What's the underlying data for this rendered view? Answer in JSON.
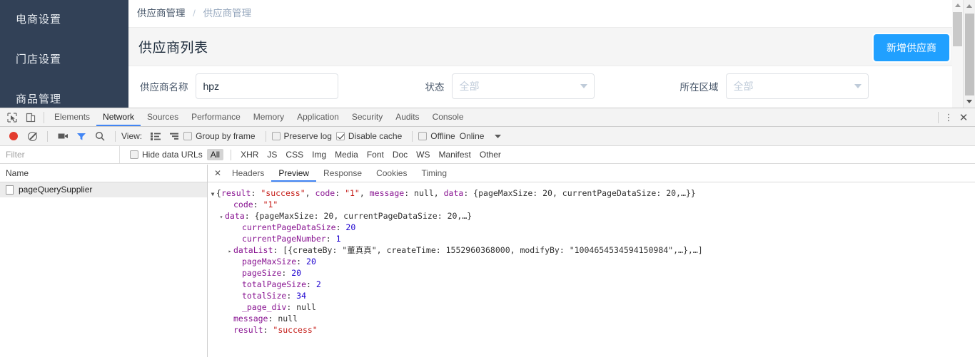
{
  "app": {
    "sidebar": {
      "items": [
        {
          "label": "电商设置",
          "name": "sidebar-item-ecommerce-settings"
        },
        {
          "label": "门店设置",
          "name": "sidebar-item-store-settings"
        },
        {
          "label": "商品管理",
          "name": "sidebar-item-product-management"
        }
      ]
    },
    "breadcrumb": {
      "current": "供应商管理",
      "separator": "/",
      "sub": "供应商管理"
    },
    "panel": {
      "title": "供应商列表",
      "add_button": "新增供应商"
    },
    "filters": [
      {
        "label": "供应商名称",
        "type": "text",
        "value": "hpz",
        "placeholder": ""
      },
      {
        "label": "状态",
        "type": "select",
        "value": "全部"
      },
      {
        "label": "所在区域",
        "type": "select",
        "value": "全部"
      }
    ]
  },
  "devtools": {
    "tabs": [
      {
        "label": "Elements",
        "active": false
      },
      {
        "label": "Network",
        "active": true
      },
      {
        "label": "Sources",
        "active": false
      },
      {
        "label": "Performance",
        "active": false
      },
      {
        "label": "Memory",
        "active": false
      },
      {
        "label": "Application",
        "active": false
      },
      {
        "label": "Security",
        "active": false
      },
      {
        "label": "Audits",
        "active": false
      },
      {
        "label": "Console",
        "active": false
      }
    ],
    "toolbar": {
      "view_label": "View:",
      "group_by_frame": {
        "label": "Group by frame",
        "checked": false
      },
      "preserve_log": {
        "label": "Preserve log",
        "checked": false
      },
      "disable_cache": {
        "label": "Disable cache",
        "checked": true
      },
      "offline": {
        "label": "Offline",
        "checked": false
      },
      "throttling": "Online"
    },
    "filterbar": {
      "placeholder": "Filter",
      "value": "",
      "hide_data_urls": {
        "label": "Hide data URLs",
        "checked": false
      },
      "types": [
        {
          "label": "All",
          "selected": true
        },
        {
          "label": "XHR",
          "selected": false
        },
        {
          "label": "JS",
          "selected": false
        },
        {
          "label": "CSS",
          "selected": false
        },
        {
          "label": "Img",
          "selected": false
        },
        {
          "label": "Media",
          "selected": false
        },
        {
          "label": "Font",
          "selected": false
        },
        {
          "label": "Doc",
          "selected": false
        },
        {
          "label": "WS",
          "selected": false
        },
        {
          "label": "Manifest",
          "selected": false
        },
        {
          "label": "Other",
          "selected": false
        }
      ]
    },
    "request_list": {
      "column_header": "Name",
      "rows": [
        {
          "name": "pageQuerySupplier",
          "selected": true
        }
      ]
    },
    "detail_tabs": [
      {
        "label": "Headers",
        "active": false
      },
      {
        "label": "Preview",
        "active": true
      },
      {
        "label": "Response",
        "active": false
      },
      {
        "label": "Cookies",
        "active": false
      },
      {
        "label": "Timing",
        "active": false
      }
    ],
    "preview": {
      "root_summary": {
        "pre": "{",
        "k1": "result",
        "v1": "\"success\"",
        "k2": "code",
        "v2": "\"1\"",
        "k3": "message",
        "v3": "null",
        "k4": "data",
        "v4": "{pageMaxSize: 20, currentPageDataSize: 20,…}}"
      },
      "lines": [
        {
          "indent": 2,
          "tri": "",
          "key": "code",
          "value": "\"1\"",
          "vtype": "string"
        },
        {
          "indent": 1,
          "tri": "▾",
          "key": "data",
          "value": "{pageMaxSize: 20, currentPageDataSize: 20,…}",
          "vtype": "plain"
        },
        {
          "indent": 3,
          "tri": "",
          "key": "currentPageDataSize",
          "value": "20",
          "vtype": "number"
        },
        {
          "indent": 3,
          "tri": "",
          "key": "currentPageNumber",
          "value": "1",
          "vtype": "number"
        },
        {
          "indent": 2,
          "tri": "▸",
          "key": "dataList",
          "value": "[{createBy: \"董真真\", createTime: 1552960368000, modifyBy: \"1004654534594150984\",…},…]",
          "vtype": "mixed"
        },
        {
          "indent": 3,
          "tri": "",
          "key": "pageMaxSize",
          "value": "20",
          "vtype": "number"
        },
        {
          "indent": 3,
          "tri": "",
          "key": "pageSize",
          "value": "20",
          "vtype": "number"
        },
        {
          "indent": 3,
          "tri": "",
          "key": "totalPageSize",
          "value": "2",
          "vtype": "number"
        },
        {
          "indent": 3,
          "tri": "",
          "key": "totalSize",
          "value": "34",
          "vtype": "number"
        },
        {
          "indent": 3,
          "tri": "",
          "key": "_page_div",
          "value": "null",
          "vtype": "null"
        },
        {
          "indent": 2,
          "tri": "",
          "key": "message",
          "value": "null",
          "vtype": "null"
        },
        {
          "indent": 2,
          "tri": "",
          "key": "result",
          "value": "\"success\"",
          "vtype": "string"
        }
      ]
    }
  },
  "colors": {
    "sidebar_bg": "#324157",
    "accent_blue": "#20a0ff",
    "devtools_tab_active": "#4285f4",
    "record_red": "#e33b2e",
    "filter_active_blue": "#4285f4"
  }
}
